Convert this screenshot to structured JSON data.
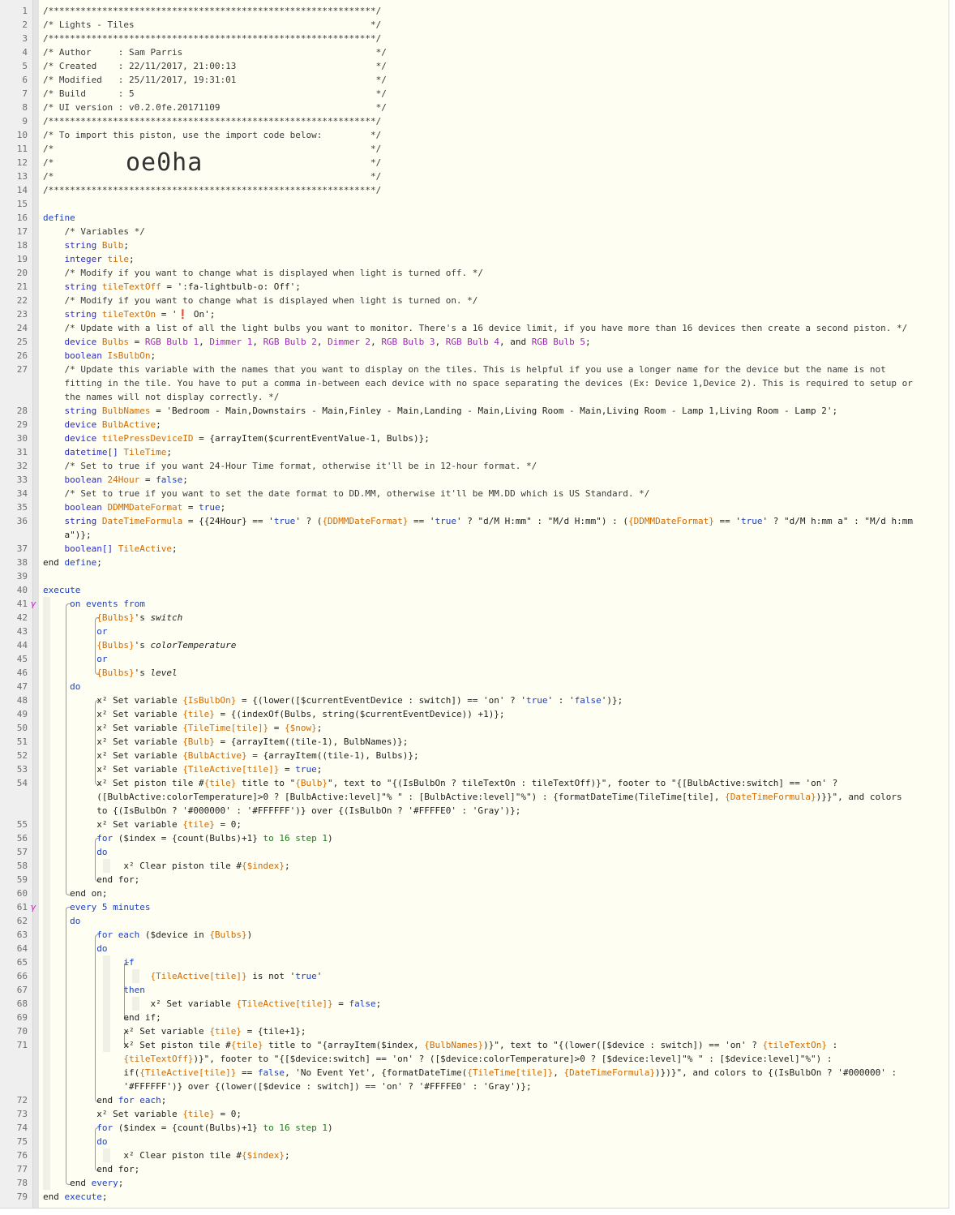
{
  "import_code": "oe0ha",
  "lines": [
    {
      "n": "1",
      "t": "/*************************************************************/"
    },
    {
      "n": "2",
      "t": "/* Lights - Tiles                                            */"
    },
    {
      "n": "3",
      "t": "/*************************************************************/"
    },
    {
      "n": "4",
      "t": "/* Author     : Sam Parris                                    */"
    },
    {
      "n": "5",
      "t": "/* Created    : 22/11/2017, 21:00:13                          */"
    },
    {
      "n": "6",
      "t": "/* Modified   : 25/11/2017, 19:31:01                          */"
    },
    {
      "n": "7",
      "t": "/* Build      : 5                                             */"
    },
    {
      "n": "8",
      "t": "/* UI version : v0.2.0fe.20171109                             */"
    },
    {
      "n": "9",
      "t": "/*************************************************************/"
    },
    {
      "n": "10",
      "t": "/* To import this piston, use the import code below:         */"
    },
    {
      "n": "11",
      "t": "/*                                                           */"
    },
    {
      "n": "12",
      "t": "/*                                                           */"
    },
    {
      "n": "13",
      "t": "/*                                                           */"
    },
    {
      "n": "14",
      "t": "/*************************************************************/"
    },
    {
      "n": "15",
      "t": ""
    },
    {
      "n": "16",
      "t": "define"
    },
    {
      "n": "17",
      "t": "    /* Variables */"
    },
    {
      "n": "18",
      "t": "    string Bulb;"
    },
    {
      "n": "19",
      "t": "    integer tile;"
    },
    {
      "n": "20",
      "t": "    /* Modify if you want to change what is displayed when light is turned off. */"
    },
    {
      "n": "21",
      "t": "    string tileTextOff = ':fa-lightbulb-o: Off';"
    },
    {
      "n": "22",
      "t": "    /* Modify if you want to change what is displayed when light is turned on. */"
    },
    {
      "n": "23",
      "t": "    string tileTextOn = '❗ On';"
    },
    {
      "n": "24",
      "t": "    /* Update with a list of all the light bulbs you want to monitor. There's a 16 device limit, if you have more than 16 devices then create a second piston. */"
    },
    {
      "n": "25",
      "t": "    device Bulbs = RGB Bulb 1, Dimmer 1, RGB Bulb 2, Dimmer 2, RGB Bulb 3, RGB Bulb 4, and RGB Bulb 5;"
    },
    {
      "n": "26",
      "t": "    boolean IsBulbOn;"
    },
    {
      "n": "27",
      "t": "    /* Update this variable with the names that you want to display on the tiles. This is helpful if you use a longer name for the device but the name is not"
    },
    {
      "n": "",
      "t": "    fitting in the tile. You have to put a comma in-between each device with no space separating the devices (Ex: Device 1,Device 2). This is required to setup or"
    },
    {
      "n": "",
      "t": "    the names will not display correctly. */"
    },
    {
      "n": "28",
      "t": "    string BulbNames = 'Bedroom - Main,Downstairs - Main,Finley - Main,Landing - Main,Living Room - Main,Living Room - Lamp 1,Living Room - Lamp 2';"
    },
    {
      "n": "29",
      "t": "    device BulbActive;"
    },
    {
      "n": "30",
      "t": "    device tilePressDeviceID = {arrayItem($currentEventValue-1, Bulbs)};"
    },
    {
      "n": "31",
      "t": "    datetime[] TileTime;"
    },
    {
      "n": "32",
      "t": "    /* Set to true if you want 24-Hour Time format, otherwise it'll be in 12-hour format. */"
    },
    {
      "n": "33",
      "t": "    boolean 24Hour = false;"
    },
    {
      "n": "34",
      "t": "    /* Set to true if you want to set the date format to DD.MM, otherwise it'll be MM.DD which is US Standard. */"
    },
    {
      "n": "35",
      "t": "    boolean DDMMDateFormat = true;"
    },
    {
      "n": "36",
      "t": "    string DateTimeFormula = {{24Hour} == 'true' ? ({DDMMDateFormat} == 'true' ? \"d/M H:mm\" : \"M/d H:mm\") : ({DDMMDateFormat} == 'true' ? \"d/M h:mm a\" : \"M/d h:mm"
    },
    {
      "n": "",
      "t": "    a\")};"
    },
    {
      "n": "37",
      "t": "    boolean[] TileActive;"
    },
    {
      "n": "38",
      "t": "end define;"
    },
    {
      "n": "39",
      "t": ""
    },
    {
      "n": "40",
      "t": "execute"
    },
    {
      "n": "41",
      "t": "     on events from"
    },
    {
      "n": "42",
      "t": "          {Bulbs}'s switch"
    },
    {
      "n": "43",
      "t": "          or"
    },
    {
      "n": "44",
      "t": "          {Bulbs}'s colorTemperature"
    },
    {
      "n": "45",
      "t": "          or"
    },
    {
      "n": "46",
      "t": "          {Bulbs}'s level"
    },
    {
      "n": "47",
      "t": "     do"
    },
    {
      "n": "48",
      "t": "          x² Set variable {IsBulbOn} = {(lower([$currentEventDevice : switch]) == 'on' ? 'true' : 'false')};"
    },
    {
      "n": "49",
      "t": "          x² Set variable {tile} = {(indexOf(Bulbs, string($currentEventDevice)) +1)};"
    },
    {
      "n": "50",
      "t": "          x² Set variable {TileTime[tile]} = {$now};"
    },
    {
      "n": "51",
      "t": "          x² Set variable {Bulb} = {arrayItem((tile-1), BulbNames)};"
    },
    {
      "n": "52",
      "t": "          x² Set variable {BulbActive} = {arrayItem((tile-1), Bulbs)};"
    },
    {
      "n": "53",
      "t": "          x² Set variable {TileActive[tile]} = true;"
    },
    {
      "n": "54",
      "t": "          x² Set piston tile #{tile} title to \"{Bulb}\", text to \"{(IsBulbOn ? tileTextOn : tileTextOff)}\", footer to \"{[BulbActive:switch] == 'on' ?"
    },
    {
      "n": "",
      "t": "          ([BulbActive:colorTemperature]>0 ? [BulbActive:level]\"% \" : [BulbActive:level]\"%\") : {formatDateTime(TileTime[tile], {DateTimeFormula})}}\", and colors"
    },
    {
      "n": "",
      "t": "          to {(IsBulbOn ? '#000000' : '#FFFFFF')} over {(IsBulbOn ? '#FFFFE0' : 'Gray')};"
    },
    {
      "n": "55",
      "t": "          x² Set variable {tile} = 0;"
    },
    {
      "n": "56",
      "t": "          for ($index = {count(Bulbs)+1} to 16 step 1)"
    },
    {
      "n": "57",
      "t": "          do"
    },
    {
      "n": "58",
      "t": "               x² Clear piston tile #{$index};"
    },
    {
      "n": "59",
      "t": "          end for;"
    },
    {
      "n": "60",
      "t": "     end on;"
    },
    {
      "n": "61",
      "t": "     every 5 minutes"
    },
    {
      "n": "62",
      "t": "     do"
    },
    {
      "n": "63",
      "t": "          for each ($device in {Bulbs})"
    },
    {
      "n": "64",
      "t": "          do"
    },
    {
      "n": "65",
      "t": "               if"
    },
    {
      "n": "66",
      "t": "                    {TileActive[tile]} is not 'true'"
    },
    {
      "n": "67",
      "t": "               then"
    },
    {
      "n": "68",
      "t": "                    x² Set variable {TileActive[tile]} = false;"
    },
    {
      "n": "69",
      "t": "               end if;"
    },
    {
      "n": "70",
      "t": "               x² Set variable {tile} = {tile+1};"
    },
    {
      "n": "71",
      "t": "               x² Set piston tile #{tile} title to \"{arrayItem($index, {BulbNames})}\", text to \"{(lower([$device : switch]) == 'on' ? {tileTextOn} :"
    },
    {
      "n": "",
      "t": "               {tileTextOff})}\", footer to \"{[$device:switch] == 'on' ? ([$device:colorTemperature]>0 ? [$device:level]\"% \" : [$device:level]\"%\") :"
    },
    {
      "n": "",
      "t": "               if({TileActive[tile]} == false, 'No Event Yet', {formatDateTime({TileTime[tile]}, {DateTimeFormula})})}\", and colors to {(IsBulbOn ? '#000000' :"
    },
    {
      "n": "",
      "t": "               '#FFFFFF')} over {(lower([$device : switch]) == 'on' ? '#FFFFE0' : 'Gray')};"
    },
    {
      "n": "72",
      "t": "          end for each;"
    },
    {
      "n": "73",
      "t": "          x² Set variable {tile} = 0;"
    },
    {
      "n": "74",
      "t": "          for ($index = {count(Bulbs)+1} to 16 step 1)"
    },
    {
      "n": "75",
      "t": "          do"
    },
    {
      "n": "76",
      "t": "               x² Clear piston tile #{$index};"
    },
    {
      "n": "77",
      "t": "          end for;"
    },
    {
      "n": "78",
      "t": "     end every;"
    },
    {
      "n": "79",
      "t": "end execute;"
    }
  ],
  "gutter_markers": [
    {
      "line": "41",
      "label": "γ"
    },
    {
      "line": "61",
      "label": "γ"
    }
  ],
  "colors": {
    "background": "#fefef2",
    "gutter": "#efefef",
    "keyword": "#1c3fc2",
    "variable": "#d26a00",
    "device": "#9c28b8",
    "expression": "#1f7a1f"
  }
}
